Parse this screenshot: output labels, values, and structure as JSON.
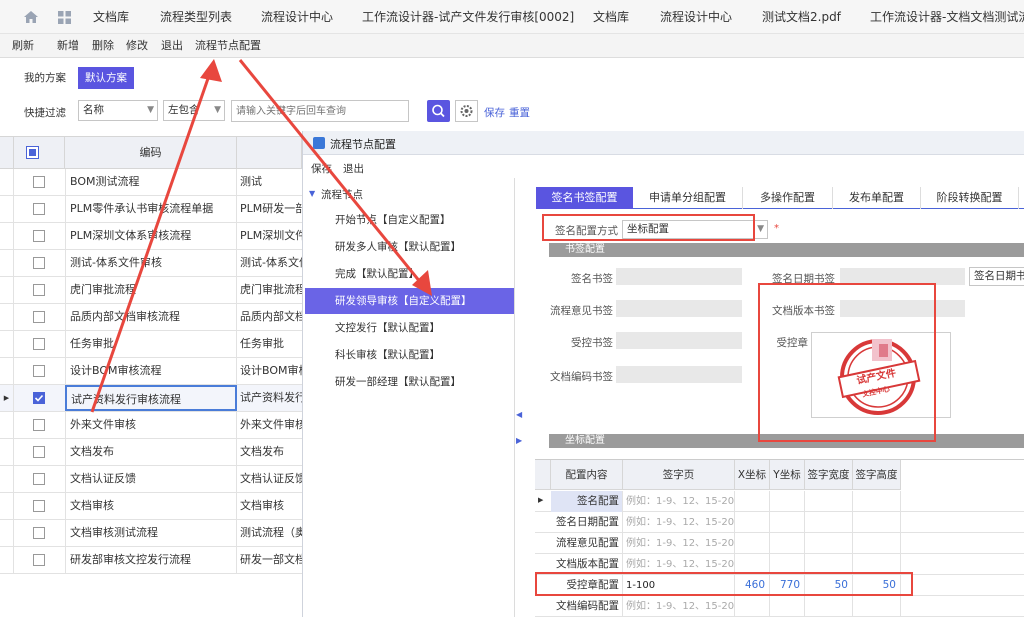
{
  "topnav": {
    "tabs": [
      "文档库",
      "流程类型列表",
      "流程设计中心",
      "工作流设计器-试产文件发行审核[0002]",
      "文档库",
      "流程设计中心",
      "测试文档2.pdf",
      "工作流设计器-文档文档测试流程"
    ]
  },
  "toolbar": {
    "items": [
      "刷新",
      "新增",
      "删除",
      "修改",
      "退出",
      "流程节点配置"
    ]
  },
  "scheme": {
    "my": "我的方案",
    "default": "默认方案"
  },
  "filter": {
    "label": "快捷过滤",
    "field": "名称",
    "op": "左包含",
    "placeholder": "请输入关键字后回车查询",
    "save": "保存",
    "reset": "重置"
  },
  "grid": {
    "header": "编码",
    "rows": [
      {
        "name": "BOM测试流程",
        "col2": "测试",
        "checked": false
      },
      {
        "name": "PLM零件承认书审核流程单据",
        "col2": "PLM研发一部",
        "checked": false
      },
      {
        "name": "PLM深圳文体系审核流程",
        "col2": "PLM深圳文件",
        "checked": false
      },
      {
        "name": "测试-体系文件审核",
        "col2": "测试-体系文件",
        "checked": false
      },
      {
        "name": "虎门审批流程",
        "col2": "虎门审批流程",
        "checked": false
      },
      {
        "name": "品质内部文档审核流程",
        "col2": "品质内部文档",
        "checked": false
      },
      {
        "name": "任务审批",
        "col2": "任务审批",
        "checked": false
      },
      {
        "name": "设计BOM审核流程",
        "col2": "设计BOM审核",
        "checked": false
      },
      {
        "name": "试产资料发行审核流程",
        "col2": "试产资料发行",
        "checked": true
      },
      {
        "name": "外来文件审核",
        "col2": "外来文件审核",
        "checked": false
      },
      {
        "name": "文档发布",
        "col2": "文档发布",
        "checked": false
      },
      {
        "name": "文档认证反馈",
        "col2": "文档认证反馈",
        "checked": false
      },
      {
        "name": "文档审核",
        "col2": "文档审核",
        "checked": false
      },
      {
        "name": "文档审核测试流程",
        "col2": "测试流程（奥",
        "checked": false
      },
      {
        "name": "研发部审核文控发行流程",
        "col2": "研发一部文档",
        "checked": false
      }
    ]
  },
  "dialog": {
    "title": "流程节点配置",
    "save": "保存",
    "exit": "退出",
    "tree_root": "流程节点",
    "nodes": [
      "开始节点【自定义配置】",
      "研发多人审核【默认配置】",
      "完成【默认配置】",
      "研发领导审核【自定义配置】",
      "文控发行【默认配置】",
      "科长审核【默认配置】",
      "研发一部经理【默认配置】"
    ],
    "tabs": [
      "签名书签配置",
      "申请单分组配置",
      "多操作配置",
      "发布单配置",
      "阶段转换配置"
    ],
    "sign_mode_label": "签名配置方式",
    "sign_mode_value": "坐标配置",
    "section_bookmark": "书签配置",
    "section_coord": "坐标配置",
    "fields": {
      "sign": "签名书签",
      "date": "签名日期书签",
      "date_value": "签名日期书",
      "opinion": "流程意见书签",
      "version": "文档版本书签",
      "controlled": "受控书签",
      "stamp": "受控章",
      "code": "文档编码书签"
    },
    "stamp_text": "试产文件",
    "stamp_sub": "文控中心",
    "table": {
      "headers": [
        "配置内容",
        "签字页",
        "X坐标",
        "Y坐标",
        "签字宽度",
        "签字高度"
      ],
      "rows": [
        {
          "key": "签名配置",
          "page": "例如：1-9、12、15-20",
          "x": "",
          "y": "",
          "w": "",
          "h": ""
        },
        {
          "key": "签名日期配置",
          "page": "例如：1-9、12、15-20",
          "x": "",
          "y": "",
          "w": "",
          "h": ""
        },
        {
          "key": "流程意见配置",
          "page": "例如：1-9、12、15-20",
          "x": "",
          "y": "",
          "w": "",
          "h": ""
        },
        {
          "key": "文档版本配置",
          "page": "例如：1-9、12、15-20",
          "x": "",
          "y": "",
          "w": "",
          "h": ""
        },
        {
          "key": "受控章配置",
          "page": "1-100",
          "x": "460",
          "y": "770",
          "w": "50",
          "h": "50"
        },
        {
          "key": "文档编码配置",
          "page": "例如：1-9、12、15-20",
          "x": "",
          "y": "",
          "w": "",
          "h": ""
        }
      ]
    }
  },
  "colors": {
    "accent": "#5a55e0",
    "annotation": "#e8473e",
    "selected_node": "#6a64e6"
  }
}
